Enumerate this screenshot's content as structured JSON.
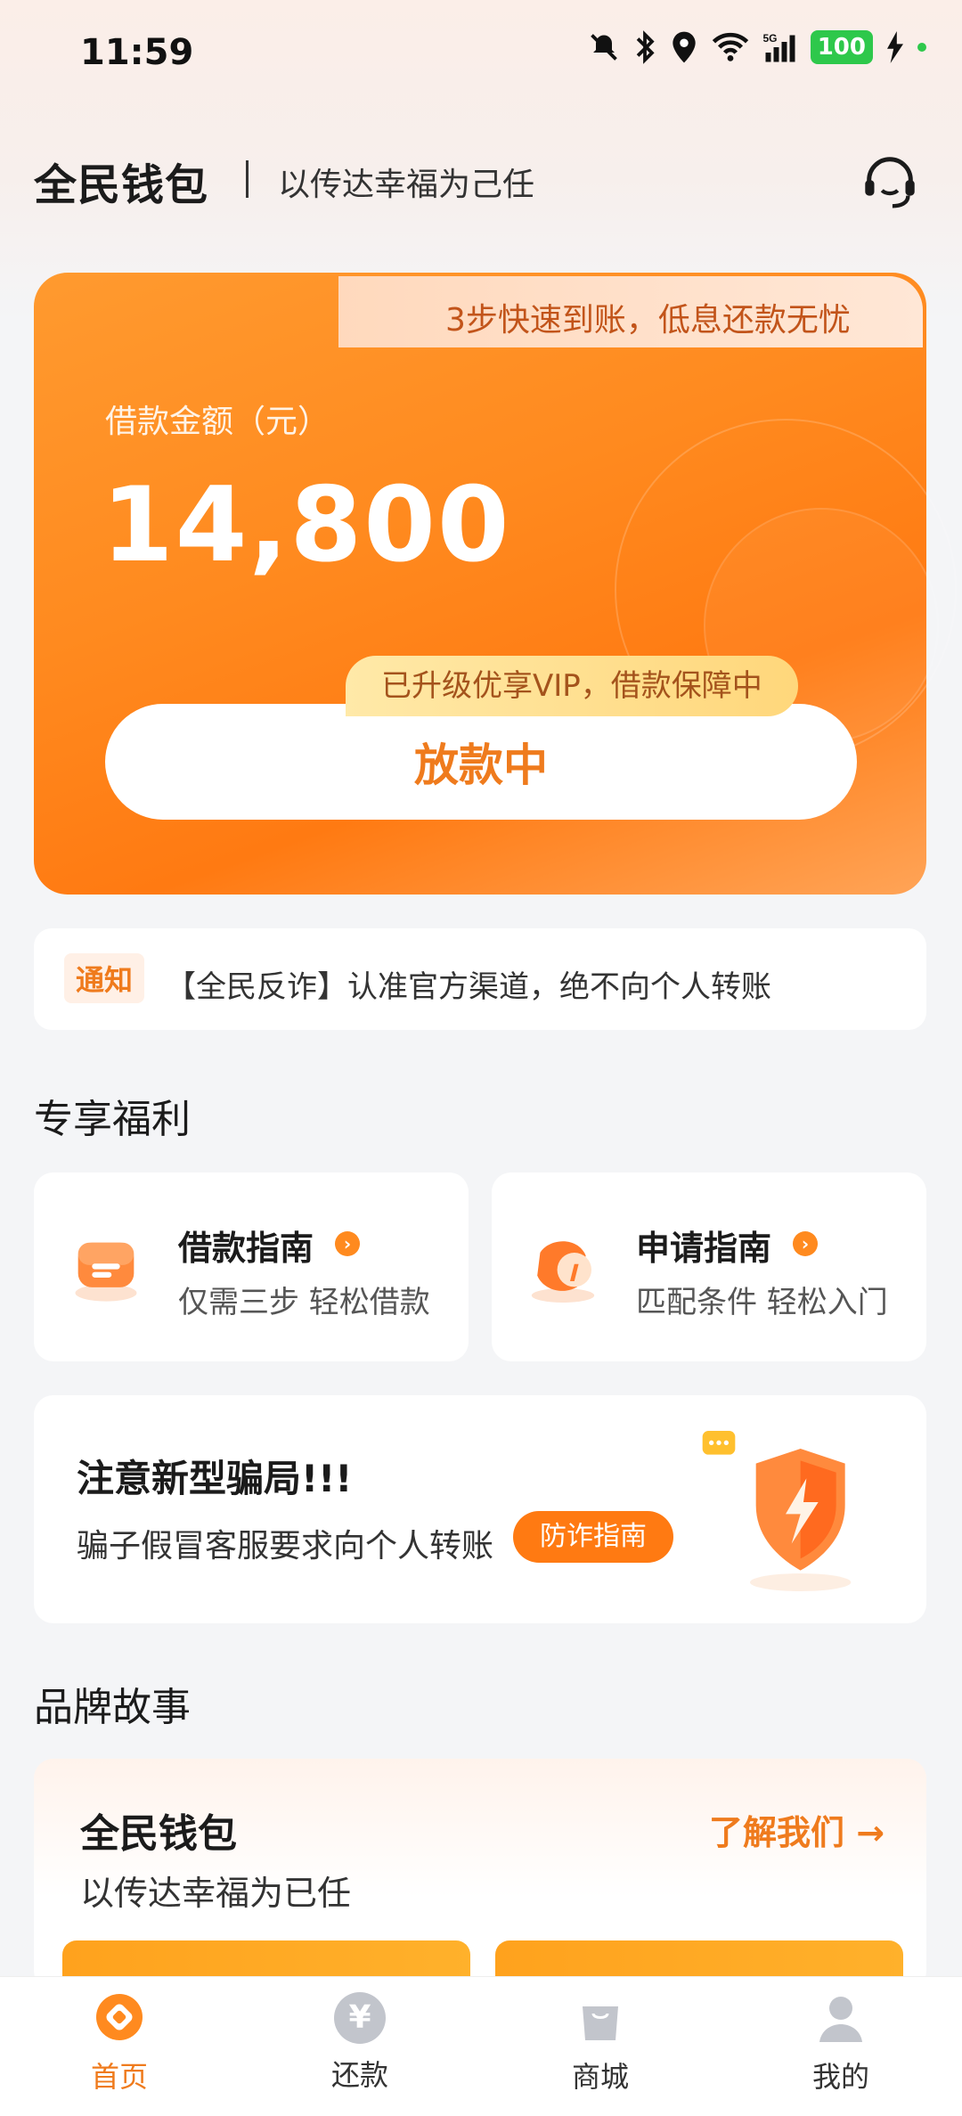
{
  "status_bar": {
    "time": "11:59",
    "battery": "100",
    "network": "5G",
    "icons": [
      "mute-bell-icon",
      "bluetooth-icon",
      "location-icon",
      "wifi-icon",
      "signal-icon",
      "battery-icon",
      "charging-icon"
    ]
  },
  "header": {
    "brand": "全民钱包",
    "slogan": "以传达幸福为己任",
    "support_icon": "headset-icon"
  },
  "loan_card": {
    "promo": "3步快速到账，低息还款无忧",
    "amount_label": "借款金额（元）",
    "amount": "14,800",
    "vip_badge": "已升级优享VIP，借款保障中",
    "status_button": "放款中"
  },
  "notice": {
    "tag": "通知",
    "text": "【全民反诈】认准官方渠道，绝不向个人转账"
  },
  "benefits": {
    "title": "专享福利",
    "items": [
      {
        "title": "借款指南",
        "subtitle": "仅需三步 轻松借款",
        "icon": "loan-guide-icon"
      },
      {
        "title": "申请指南",
        "subtitle": "匹配条件 轻松入门",
        "icon": "compass-icon"
      }
    ]
  },
  "fraud_alert": {
    "title": "注意新型骗局!!!",
    "subtitle": "骗子假冒客服要求向个人转账",
    "button": "防诈指南",
    "icon": "shield-lightning-icon"
  },
  "brand_story": {
    "section_title": "品牌故事",
    "title": "全民钱包",
    "subtitle": "以传达幸福为已任",
    "link": "了解我们 →"
  },
  "nav": {
    "items": [
      {
        "label": "首页",
        "icon": "home-icon",
        "active": true
      },
      {
        "label": "还款",
        "icon": "yen-icon",
        "active": false
      },
      {
        "label": "商城",
        "icon": "shopping-bag-icon",
        "active": false
      },
      {
        "label": "我的",
        "icon": "profile-icon",
        "active": false
      }
    ]
  },
  "colors": {
    "accent": "#ff8a1f",
    "accent_text": "#ef7b1d",
    "nav_inactive": "#b9bcc3"
  }
}
